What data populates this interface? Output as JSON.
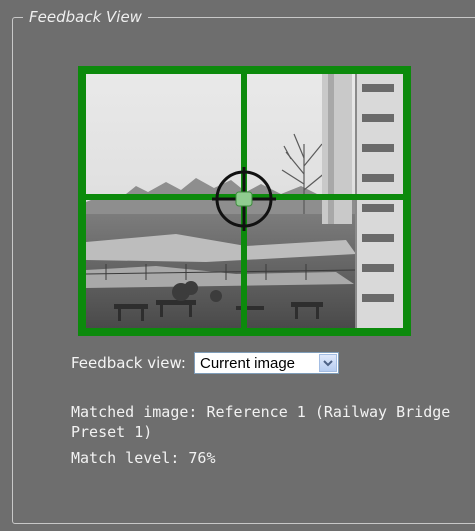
{
  "panel": {
    "legend": "Feedback View"
  },
  "preview": {
    "grid_color": "#0c8a0c",
    "marker_icon": "crosshair-target-icon"
  },
  "feedback": {
    "label": "Feedback view:",
    "selected": "Current image"
  },
  "match": {
    "image_line1": "Matched image: Reference 1 (Railway Bridge",
    "image_line2": "Preset 1)",
    "level": "Match level: 76%",
    "level_percent": 76
  }
}
